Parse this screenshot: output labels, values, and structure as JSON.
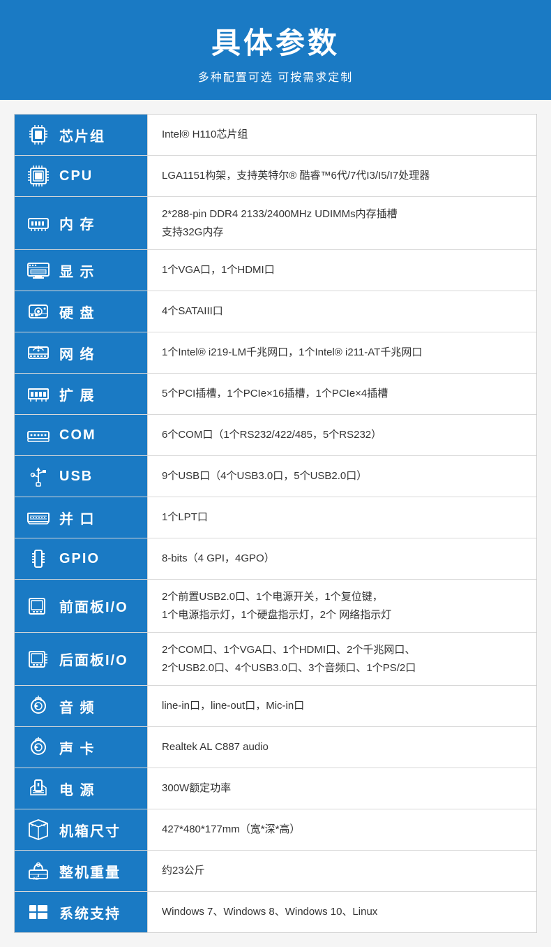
{
  "header": {
    "title": "具体参数",
    "subtitle": "多种配置可选 可按需求定制"
  },
  "rows": [
    {
      "id": "chipset",
      "icon": "chip",
      "label": "芯片组",
      "value": "Intel® H110芯片组",
      "multiline": false
    },
    {
      "id": "cpu",
      "icon": "cpu",
      "label": "CPU",
      "value": "LGA1151构架，支持英特尔® 酷睿™6代/7代I3/I5/I7处理器",
      "multiline": false
    },
    {
      "id": "memory",
      "icon": "memory",
      "label": "内 存",
      "value1": "2*288-pin DDR4 2133/2400MHz UDIMMs内存插槽",
      "value2": "支持32G内存",
      "multiline": true
    },
    {
      "id": "display",
      "icon": "display",
      "label": "显 示",
      "value": "1个VGA口，1个HDMI口",
      "multiline": false
    },
    {
      "id": "harddisk",
      "icon": "harddisk",
      "label": "硬 盘",
      "value": "4个SATAIII口",
      "multiline": false
    },
    {
      "id": "network",
      "icon": "network",
      "label": "网 络",
      "value": "1个Intel® i219-LM千兆网口，1个Intel® i211-AT千兆网口",
      "multiline": false
    },
    {
      "id": "expansion",
      "icon": "expansion",
      "label": "扩 展",
      "value": "5个PCI插槽，1个PCIe×16插槽，1个PCIe×4插槽",
      "multiline": false
    },
    {
      "id": "com",
      "icon": "com",
      "label": "COM",
      "value": "6个COM口（1个RS232/422/485，5个RS232）",
      "multiline": false
    },
    {
      "id": "usb",
      "icon": "usb",
      "label": "USB",
      "value": "9个USB口（4个USB3.0口，5个USB2.0口）",
      "multiline": false
    },
    {
      "id": "parallel",
      "icon": "parallel",
      "label": "并 口",
      "value": "1个LPT口",
      "multiline": false
    },
    {
      "id": "gpio",
      "icon": "gpio",
      "label": "GPIO",
      "value": "8-bits（4 GPI，4GPO）",
      "multiline": false
    },
    {
      "id": "frontpanel",
      "icon": "frontpanel",
      "label": "前面板I/O",
      "value1": "2个前置USB2.0口、1个电源开关，1个复位键，",
      "value2": "1个电源指示灯，1个硬盘指示灯，2个 网络指示灯",
      "multiline": true
    },
    {
      "id": "rearpanel",
      "icon": "rearpanel",
      "label": "后面板I/O",
      "value1": "2个COM口、1个VGA口、1个HDMI口、2个千兆网口、",
      "value2": "2个USB2.0口、4个USB3.0口、3个音频口、1个PS/2口",
      "multiline": true
    },
    {
      "id": "audio",
      "icon": "audio",
      "label": "音 频",
      "value": "line-in口，line-out口，Mic-in口",
      "multiline": false
    },
    {
      "id": "soundcard",
      "icon": "soundcard",
      "label": "声 卡",
      "value": "Realtek AL C887 audio",
      "multiline": false
    },
    {
      "id": "power",
      "icon": "power",
      "label": "电 源",
      "value": "300W额定功率",
      "multiline": false
    },
    {
      "id": "chassis",
      "icon": "chassis",
      "label": "机箱尺寸",
      "value": "427*480*177mm（宽*深*高）",
      "multiline": false
    },
    {
      "id": "weight",
      "icon": "weight",
      "label": "整机重量",
      "value": "约23公斤",
      "multiline": false
    },
    {
      "id": "os",
      "icon": "os",
      "label": "系统支持",
      "value": "Windows 7、Windows 8、Windows 10、Linux",
      "multiline": false
    }
  ]
}
